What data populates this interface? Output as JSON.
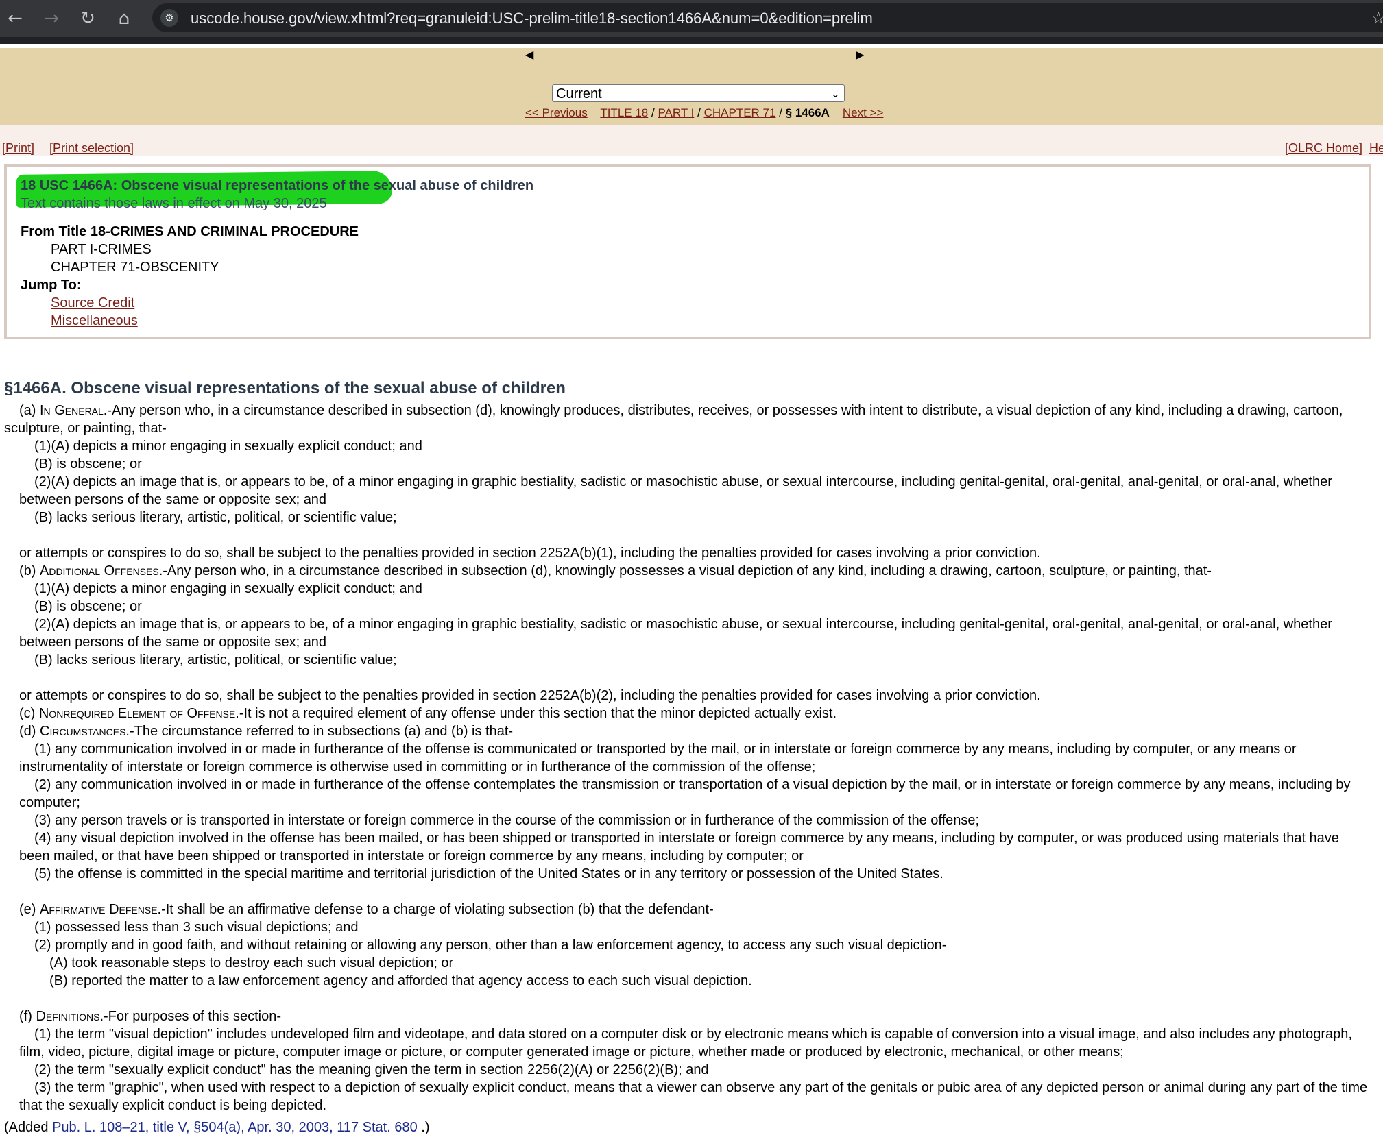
{
  "browser": {
    "url": "uscode.house.gov/view.xhtml?req=granuleid:USC-prelim-title18-section1466A&num=0&edition=prelim"
  },
  "nav": {
    "edition_selected": "Current",
    "previous": "<< Previous",
    "title": "TITLE 18",
    "part": "PART I",
    "chapter": "CHAPTER 71",
    "current": "§ 1466A",
    "next": "Next >>",
    "sep": "/"
  },
  "printbar": {
    "print": "[Print]",
    "print_selection": "[Print selection]",
    "olrc_home": "[OLRC Home]",
    "help": "He"
  },
  "header": {
    "title": "18 USC 1466A: Obscene visual representations of the sexual abuse of children",
    "subtitle": "Text contains those laws in effect on May 30, 2025",
    "from": "From Title 18-CRIMES AND CRIMINAL PROCEDURE",
    "part": "PART I-CRIMES",
    "chapter": "CHAPTER 71-OBSCENITY",
    "jump_to": "Jump To:",
    "jump_links": [
      "Source Credit",
      "Miscellaneous"
    ]
  },
  "section": {
    "heading": "§1466A. Obscene visual representations of the sexual abuse of children",
    "a": {
      "label": "(a) ",
      "heading": "In General.",
      "text": "-Any person who, in a circumstance described in subsection (d), knowingly produces, distributes, receives, or possesses with intent to distribute, a visual depiction of any kind, including a drawing, cartoon, sculpture, or painting, that-",
      "items": [
        "(1)(A) depicts a minor engaging in sexually explicit conduct; and",
        "(B) is obscene; or",
        "(2)(A) depicts an image that is, or appears to be, of a minor engaging in graphic bestiality, sadistic or masochistic abuse, or sexual intercourse, including genital-genital, oral-genital, anal-genital, or oral-anal, whether between persons of the same or opposite sex; and",
        "(B) lacks serious literary, artistic, political, or scientific value;"
      ],
      "closing": "or attempts or conspires to do so, shall be subject to the penalties provided in section 2252A(b)(1), including the penalties provided for cases involving a prior conviction."
    },
    "b": {
      "label": "(b) ",
      "heading": "Additional Offenses.",
      "text": "-Any person who, in a circumstance described in subsection (d), knowingly possesses a visual depiction of any kind, including a drawing, cartoon, sculpture, or painting, that-",
      "items": [
        "(1)(A) depicts a minor engaging in sexually explicit conduct; and",
        "(B) is obscene; or",
        "(2)(A) depicts an image that is, or appears to be, of a minor engaging in graphic bestiality, sadistic or masochistic abuse, or sexual intercourse, including genital-genital, oral-genital, anal-genital, or oral-anal, whether between persons of the same or opposite sex; and",
        "(B) lacks serious literary, artistic, political, or scientific value;"
      ],
      "closing": "or attempts or conspires to do so, shall be subject to the penalties provided in section 2252A(b)(2), including the penalties provided for cases involving a prior conviction."
    },
    "c": {
      "label": "(c) ",
      "heading": "Nonrequired Element of Offense.",
      "text": "-It is not a required element of any offense under this section that the minor depicted actually exist."
    },
    "d": {
      "label": "(d) ",
      "heading": "Circumstances.",
      "text": "-The circumstance referred to in subsections (a) and (b) is that-",
      "items": [
        "(1) any communication involved in or made in furtherance of the offense is communicated or transported by the mail, or in interstate or foreign commerce by any means, including by computer, or any means or instrumentality of interstate or foreign commerce is otherwise used in committing or in furtherance of the commission of the offense;",
        "(2) any communication involved in or made in furtherance of the offense contemplates the transmission or transportation of a visual depiction by the mail, or in interstate or foreign commerce by any means, including by computer;",
        "(3) any person travels or is transported in interstate or foreign commerce in the course of the commission or in furtherance of the commission of the offense;",
        "(4) any visual depiction involved in the offense has been mailed, or has been shipped or transported in interstate or foreign commerce by any means, including by computer, or was produced using materials that have been mailed, or that have been shipped or transported in interstate or foreign commerce by any means, including by computer; or",
        "(5) the offense is committed in the special maritime and territorial jurisdiction of the United States or in any territory or possession of the United States."
      ]
    },
    "e": {
      "label": "(e) ",
      "heading": "Affirmative Defense.",
      "text": "-It shall be an affirmative defense to a charge of violating subsection (b) that the defendant-",
      "items": [
        "(1) possessed less than 3 such visual depictions; and",
        "(2) promptly and in good faith, and without retaining or allowing any person, other than a law enforcement agency, to access any such visual depiction-"
      ],
      "subitems": [
        "(A) took reasonable steps to destroy each such visual depiction; or",
        "(B) reported the matter to a law enforcement agency and afforded that agency access to each such visual depiction."
      ]
    },
    "f": {
      "label": "(f) ",
      "heading": "Definitions.",
      "text": "-For purposes of this section-",
      "items": [
        "(1) the term \"visual depiction\" includes undeveloped film and videotape, and data stored on a computer disk or by electronic means which is capable of conversion into a visual image, and also includes any photograph, film, video, picture, digital image or picture, computer image or picture, or computer generated image or picture, whether made or produced by electronic, mechanical, or other means;",
        "(2) the term \"sexually explicit conduct\" has the meaning given the term in section 2256(2)(A) or 2256(2)(B); and",
        "(3) the term \"graphic\", when used with respect to a depiction of sexually explicit conduct, means that a viewer can observe any part of the genitals or pubic area of any depicted person or animal during any part of the time that the sexually explicit conduct is being depicted."
      ]
    },
    "credit_prefix": "(Added ",
    "credit_link": "Pub. L. 108–21, title V, §504(a), Apr. 30, 2003, 117 Stat. 680",
    "credit_suffix": " .)"
  }
}
